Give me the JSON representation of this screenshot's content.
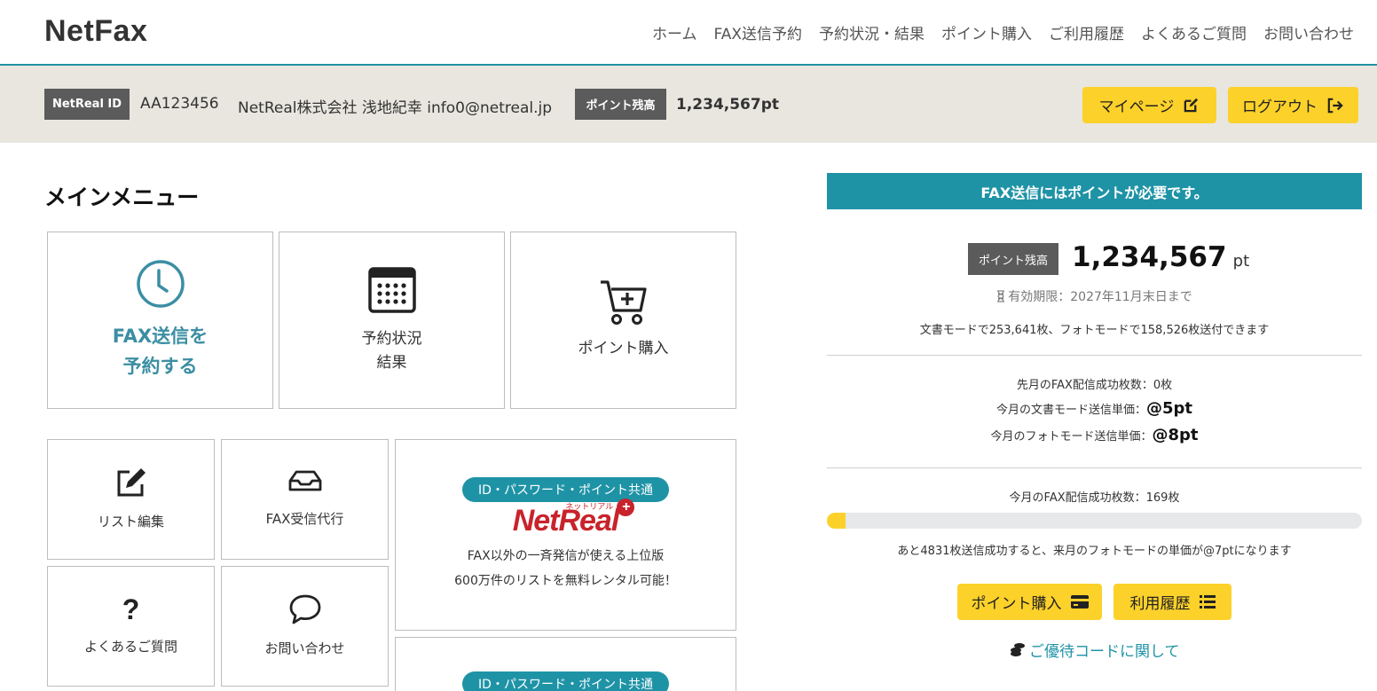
{
  "header": {
    "logo": "NetFax",
    "nav": [
      "ホーム",
      "FAX送信予約",
      "予約状況・結果",
      "ポイント購入",
      "ご利用履歴",
      "よくあるご質問",
      "お問い合わせ"
    ]
  },
  "account": {
    "id_label": "NetReal ID",
    "id_value": "AA123456",
    "company_user": "NetReal株式会社 浅地紀幸 info0@netreal.jp",
    "points_label": "ポイント残高",
    "points_value": "1,234,567pt",
    "mypage_button": "マイページ",
    "logout_button": "ログアウト"
  },
  "main_menu": {
    "title": "メインメニュー",
    "cards": [
      {
        "label": "FAX送信を\n予約する",
        "icon": "clock-icon"
      },
      {
        "label": "予約状況\n結果",
        "icon": "calendar-icon"
      },
      {
        "label": "ポイント購入",
        "icon": "cart-plus-icon"
      },
      {
        "label": "リスト編集",
        "icon": "edit-icon"
      },
      {
        "label": "FAX受信代行",
        "icon": "inbox-icon"
      },
      {
        "label": "よくあるご質問",
        "icon": "question-icon"
      },
      {
        "label": "お問い合わせ",
        "icon": "chat-bubble-icon"
      }
    ],
    "promo": {
      "pill": "ID・パスワード・ポイント共通",
      "logo_text": "NetReal",
      "logo_ruby": "ネットリアル",
      "line1": "FAX以外の一斉発信が使える上位版",
      "line2": "600万件のリストを無料レンタル可能！"
    },
    "promo2": {
      "pill": "ID・パスワード・ポイント共通"
    }
  },
  "panel": {
    "header": "FAX送信にはポイントが必要です。",
    "points_label": "ポイント残高",
    "points_value": "1,234,567",
    "points_unit": "pt",
    "expiry": "有効期限：2027年11月末日まで",
    "capacity": "文書モードで253,641枚、フォトモードで158,526枚送付できます",
    "last_month_success": "先月のFAX配信成功枚数：0枚",
    "doc_price_label": "今月の文書モード送信単価：",
    "doc_price_value": "@5pt",
    "photo_price_label": "今月のフォトモード送信単価：",
    "photo_price_value": "@8pt",
    "this_month_success": "今月のFAX配信成功枚数：169枚",
    "progress_fraction": 0.034,
    "progress_note": "あと4831枚送信成功すると、来月のフォトモードの単価が@7ptになります",
    "buy_button": "ポイント購入",
    "history_button": "利用履歴",
    "coupon_link": "ご優待コードに関して"
  },
  "colors": {
    "accent": "#1f93a6",
    "button": "#fcd12a",
    "brand_red": "#c8232c"
  }
}
